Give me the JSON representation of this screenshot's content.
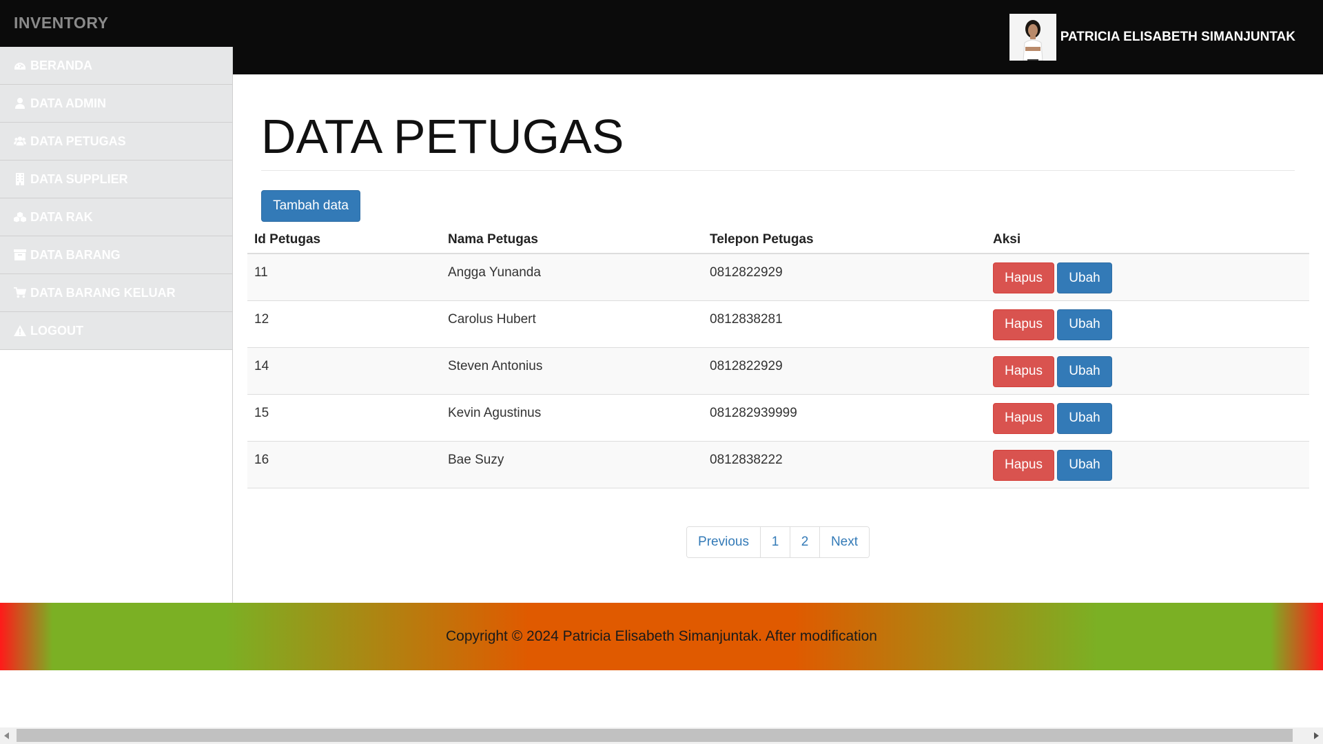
{
  "app": {
    "brand": "INVENTORY"
  },
  "user": {
    "name": "PATRICIA ELISABETH SIMANJUNTAK"
  },
  "sidebar": {
    "items": [
      {
        "label": "BERANDA",
        "icon": "dashboard-icon"
      },
      {
        "label": "DATA ADMIN",
        "icon": "user-icon"
      },
      {
        "label": "DATA PETUGAS",
        "icon": "users-icon"
      },
      {
        "label": "DATA SUPPLIER",
        "icon": "building-icon"
      },
      {
        "label": "DATA RAK",
        "icon": "cubes-icon"
      },
      {
        "label": "DATA BARANG",
        "icon": "archive-icon"
      },
      {
        "label": "DATA BARANG KELUAR",
        "icon": "cart-icon"
      },
      {
        "label": "LOGOUT",
        "icon": "warning-icon"
      }
    ]
  },
  "main": {
    "title": "DATA PETUGAS",
    "add_button": "Tambah data",
    "table": {
      "headers": [
        "Id Petugas",
        "Nama Petugas",
        "Telepon Petugas",
        "Aksi"
      ],
      "rows": [
        {
          "id": "11",
          "name": "Angga Yunanda",
          "phone": "0812822929"
        },
        {
          "id": "12",
          "name": "Carolus Hubert",
          "phone": "0812838281"
        },
        {
          "id": "14",
          "name": "Steven Antonius",
          "phone": "0812822929"
        },
        {
          "id": "15",
          "name": "Kevin Agustinus",
          "phone": "081282939999"
        },
        {
          "id": "16",
          "name": "Bae Suzy",
          "phone": "0812838222"
        }
      ],
      "delete_label": "Hapus",
      "edit_label": "Ubah"
    },
    "pagination": {
      "previous": "Previous",
      "pages": [
        "1",
        "2"
      ],
      "next": "Next"
    }
  },
  "footer": {
    "text": "Copyright © 2024 Patricia Elisabeth Simanjuntak. After modification"
  },
  "colors": {
    "header_bg": "#0b0b0b",
    "sidebar_item_bg": "#e6e7e8",
    "primary": "#337ab7",
    "danger": "#d9534f",
    "footer_green": "#7bb024",
    "footer_orange": "#e05a00",
    "footer_red": "#ff1a1a"
  }
}
